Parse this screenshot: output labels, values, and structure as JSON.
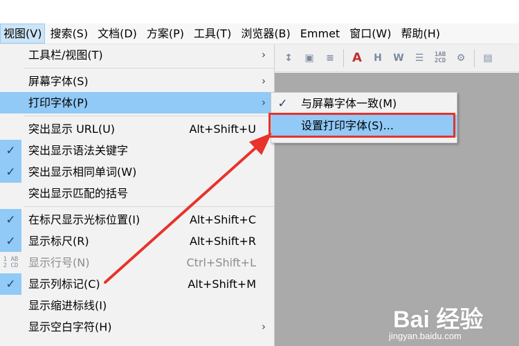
{
  "menubar": {
    "items": [
      {
        "label": "视图(V)"
      },
      {
        "label": "搜索(S)"
      },
      {
        "label": "文档(D)"
      },
      {
        "label": "方案(P)"
      },
      {
        "label": "工具(T)"
      },
      {
        "label": "浏览器(B)"
      },
      {
        "label": "Emmet"
      },
      {
        "label": "窗口(W)"
      },
      {
        "label": "帮助(H)"
      }
    ]
  },
  "view_menu": {
    "items": [
      {
        "label": "工具栏/视图(T)",
        "submenu": true
      },
      {
        "label": "屏幕字体(S)",
        "submenu": true
      },
      {
        "label": "打印字体(P)",
        "submenu": true,
        "highlighted": true
      },
      {
        "label": "突出显示 URL(U)",
        "shortcut": "Alt+Shift+U"
      },
      {
        "label": "突出显示语法关键字",
        "checked": true
      },
      {
        "label": "突出显示相同单词(W)",
        "checked": true
      },
      {
        "label": "突出显示匹配的括号"
      },
      {
        "label": "在标尺显示光标位置(I)",
        "checked": true,
        "shortcut": "Alt+Shift+C"
      },
      {
        "label": "显示标尺(R)",
        "checked": true,
        "shortcut": "Alt+Shift+R"
      },
      {
        "label": "显示行号(N)",
        "disabled": true,
        "shortcut": "Ctrl+Shift+L",
        "icon_text": "1 AB\n2 CD"
      },
      {
        "label": "显示列标记(C)",
        "checked": true,
        "shortcut": "Alt+Shift+M"
      },
      {
        "label": "显示缩进标线(I)"
      },
      {
        "label": "显示空白字符(H)",
        "submenu": true
      }
    ]
  },
  "print_font_submenu": {
    "items": [
      {
        "label": "与屏幕字体一致(M)",
        "checked": true
      },
      {
        "label": "设置打印字体(S)...",
        "highlighted": true
      }
    ]
  },
  "toolbar_icon_texts": {
    "line_numbers": "1AB\n2CD"
  },
  "watermark": {
    "main": "Bai 经验",
    "sub": "jingyan.baidu.com"
  },
  "colors": {
    "highlight": "#91c9f7",
    "annotation_red": "#e8322c",
    "workspace_gray": "#aaaaaa"
  }
}
